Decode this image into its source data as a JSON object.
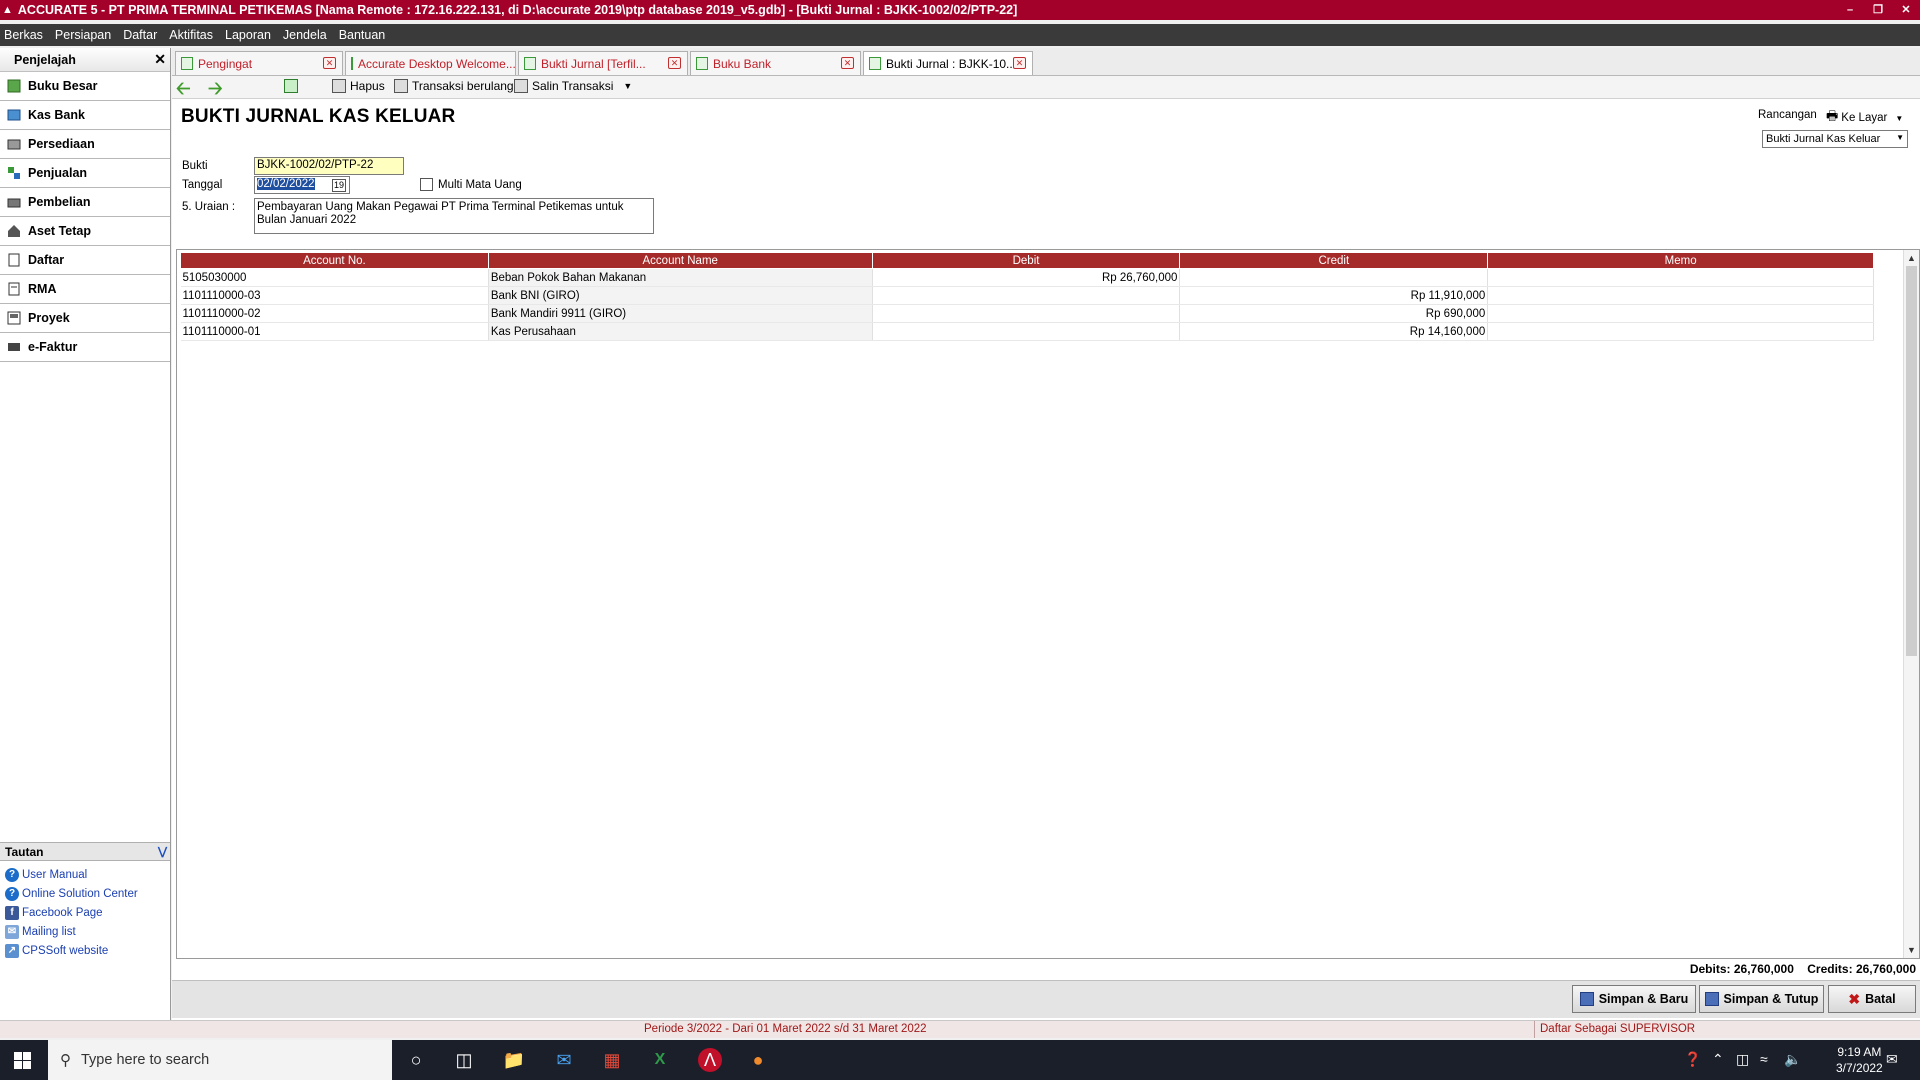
{
  "app": {
    "title": "ACCURATE 5 - PT PRIMA TERMINAL PETIKEMAS  [Nama Remote : 172.16.222.131, di D:\\accurate 2019\\ptp database 2019_v5.gdb] - [Bukti Jurnal : BJKK-1002/02/PTP-22]",
    "brand_color": "#a3002a"
  },
  "menu": [
    "Berkas",
    "Persiapan",
    "Daftar",
    "Aktifitas",
    "Laporan",
    "Jendela",
    "Bantuan"
  ],
  "sidebar": {
    "title": "Penjelajah",
    "items": [
      {
        "label": "Buku Besar",
        "icon": "ledger-icon"
      },
      {
        "label": "Kas Bank",
        "icon": "cash-bank-icon"
      },
      {
        "label": "Persediaan",
        "icon": "inventory-icon"
      },
      {
        "label": "Penjualan",
        "icon": "sales-icon"
      },
      {
        "label": "Pembelian",
        "icon": "purchase-icon"
      },
      {
        "label": "Aset Tetap",
        "icon": "fixed-asset-icon"
      },
      {
        "label": "Daftar",
        "icon": "list-icon"
      },
      {
        "label": "RMA",
        "icon": "rma-icon"
      },
      {
        "label": "Proyek",
        "icon": "project-icon"
      },
      {
        "label": "e-Faktur",
        "icon": "efaktur-icon"
      }
    ],
    "links_title": "Tautan",
    "links": [
      "User Manual",
      "Online Solution Center",
      "Facebook Page",
      "Mailing list",
      "CPSSoft website"
    ]
  },
  "tabs": [
    {
      "label": "Pengingat"
    },
    {
      "label": "Accurate Desktop Welcome..."
    },
    {
      "label": "Bukti Jurnal [Terfil..."
    },
    {
      "label": "Buku Bank"
    },
    {
      "label": "Bukti Jurnal : BJKK-10..."
    }
  ],
  "toolbar": {
    "hapus": "Hapus",
    "transaksi_berulang": "Transaksi berulang",
    "salin_transaksi": "Salin Transaksi"
  },
  "form": {
    "title": "BUKTI JURNAL KAS KELUAR",
    "bukti_label": "Bukti",
    "bukti_value": "BJKK-1002/02/PTP-22",
    "tanggal_label": "Tanggal",
    "tanggal_value": "02/02/2022",
    "multi_label": "Multi Mata Uang",
    "uraian_label": "5. Uraian :",
    "uraian_value": "Pembayaran Uang Makan Pegawai PT Prima Terminal Petikemas untuk Bulan Januari 2022",
    "rancangan_label": "Rancangan",
    "ke_layar": "Ke Layar",
    "rancangan_value": "Bukti Jurnal Kas Keluar"
  },
  "grid": {
    "headers": [
      "Account No.",
      "Account Name",
      "Debit",
      "Credit",
      "Memo"
    ],
    "rows": [
      {
        "account_no": "5105030000",
        "account_name": "Beban Pokok Bahan Makanan",
        "debit": "Rp 26,760,000",
        "credit": "",
        "memo": ""
      },
      {
        "account_no": "1101110000-03",
        "account_name": "Bank BNI (GIRO)",
        "debit": "",
        "credit": "Rp 11,910,000",
        "memo": ""
      },
      {
        "account_no": "1101110000-02",
        "account_name": "Bank Mandiri 9911 (GIRO)",
        "debit": "",
        "credit": "Rp 690,000",
        "memo": ""
      },
      {
        "account_no": "1101110000-01",
        "account_name": "Kas Perusahaan",
        "debit": "",
        "credit": "Rp 14,160,000",
        "memo": ""
      }
    ]
  },
  "totals": {
    "debits_label": "Debits:",
    "debits": "26,760,000",
    "credits_label": "Credits:",
    "credits": "26,760,000"
  },
  "buttons": {
    "simpan_baru": "Simpan & Baru",
    "simpan_tutup": "Simpan & Tutup",
    "batal": "Batal"
  },
  "status": {
    "periode": "Periode 3/2022 - Dari 01 Maret 2022 s/d 31 Maret 2022",
    "user": "Daftar Sebagai SUPERVISOR"
  },
  "taskbar": {
    "search_placeholder": "Type here to search",
    "time": "9:19 AM",
    "date": "3/7/2022"
  }
}
